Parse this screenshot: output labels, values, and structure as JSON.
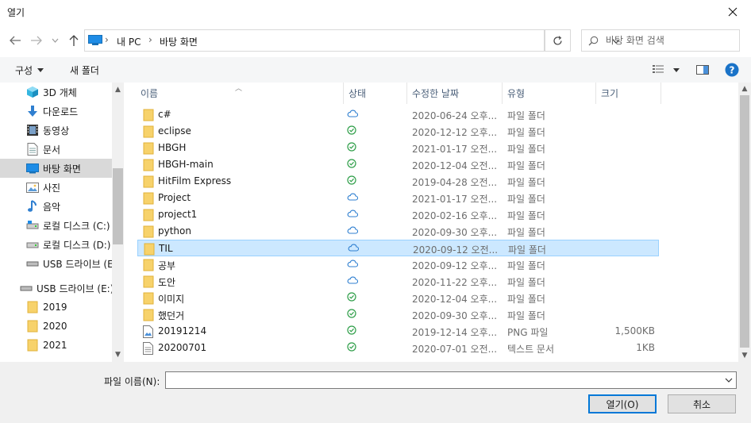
{
  "window": {
    "title": "열기"
  },
  "address": {
    "crumbs": [
      "내 PC",
      "바탕 화면"
    ],
    "search_placeholder": "바탕 화면 검색"
  },
  "toolbar": {
    "organize": "구성",
    "new_folder": "새 폴더"
  },
  "nav": {
    "items": [
      {
        "label": "3D 개체",
        "icon": "cube-icon"
      },
      {
        "label": "다운로드",
        "icon": "download-arrow-icon"
      },
      {
        "label": "동영상",
        "icon": "film-icon"
      },
      {
        "label": "문서",
        "icon": "document-icon"
      },
      {
        "label": "바탕 화면",
        "icon": "desktop-icon",
        "selected": true
      },
      {
        "label": "사진",
        "icon": "picture-icon"
      },
      {
        "label": "음악",
        "icon": "music-note-icon"
      },
      {
        "label": "로컬 디스크 (C:)",
        "icon": "drive-icon"
      },
      {
        "label": "로컬 디스크 (D:)",
        "icon": "drive-icon"
      },
      {
        "label": "USB 드라이브 (E:)",
        "icon": "usb-drive-icon"
      },
      {
        "label": "USB 드라이브 (E:)",
        "icon": "usb-drive-icon"
      },
      {
        "label": "2019",
        "icon": "folder-icon"
      },
      {
        "label": "2020",
        "icon": "folder-icon"
      },
      {
        "label": "2021",
        "icon": "folder-icon"
      }
    ]
  },
  "columns": {
    "name": "이름",
    "status": "상태",
    "modified": "수정한 날짜",
    "type": "유형",
    "size": "크기"
  },
  "files": [
    {
      "name": "c#",
      "status": "cloud",
      "date": "2020-06-24 오후...",
      "type": "파일 폴더",
      "size": "",
      "kind": "folder"
    },
    {
      "name": "eclipse",
      "status": "synced",
      "date": "2020-12-12 오후...",
      "type": "파일 폴더",
      "size": "",
      "kind": "folder"
    },
    {
      "name": "HBGH",
      "status": "synced",
      "date": "2021-01-17 오전...",
      "type": "파일 폴더",
      "size": "",
      "kind": "folder"
    },
    {
      "name": "HBGH-main",
      "status": "synced",
      "date": "2020-12-04 오전...",
      "type": "파일 폴더",
      "size": "",
      "kind": "folder"
    },
    {
      "name": "HitFilm Express",
      "status": "synced",
      "date": "2019-04-28 오전...",
      "type": "파일 폴더",
      "size": "",
      "kind": "folder"
    },
    {
      "name": "Project",
      "status": "cloud",
      "date": "2021-01-17 오전...",
      "type": "파일 폴더",
      "size": "",
      "kind": "folder"
    },
    {
      "name": "project1",
      "status": "cloud",
      "date": "2020-02-16 오후...",
      "type": "파일 폴더",
      "size": "",
      "kind": "folder"
    },
    {
      "name": "python",
      "status": "cloud",
      "date": "2020-09-30 오후...",
      "type": "파일 폴더",
      "size": "",
      "kind": "folder"
    },
    {
      "name": "TIL",
      "status": "cloud",
      "date": "2020-09-12 오전...",
      "type": "파일 폴더",
      "size": "",
      "kind": "folder",
      "selected": true
    },
    {
      "name": "공부",
      "status": "cloud",
      "date": "2020-09-12 오후...",
      "type": "파일 폴더",
      "size": "",
      "kind": "folder"
    },
    {
      "name": "도안",
      "status": "cloud",
      "date": "2020-11-22 오후...",
      "type": "파일 폴더",
      "size": "",
      "kind": "folder"
    },
    {
      "name": "이미지",
      "status": "synced",
      "date": "2020-12-04 오후...",
      "type": "파일 폴더",
      "size": "",
      "kind": "folder"
    },
    {
      "name": "했던거",
      "status": "synced",
      "date": "2020-09-30 오후...",
      "type": "파일 폴더",
      "size": "",
      "kind": "folder"
    },
    {
      "name": "20191214",
      "status": "synced",
      "date": "2019-12-14 오후...",
      "type": "PNG 파일",
      "size": "1,500KB",
      "kind": "image"
    },
    {
      "name": "20200701",
      "status": "synced",
      "date": "2020-07-01 오전...",
      "type": "텍스트 문서",
      "size": "1KB",
      "kind": "text"
    }
  ],
  "bottom": {
    "filename_label": "파일 이름(N):",
    "filename_value": "",
    "open_label": "열기(O)",
    "cancel_label": "취소"
  }
}
